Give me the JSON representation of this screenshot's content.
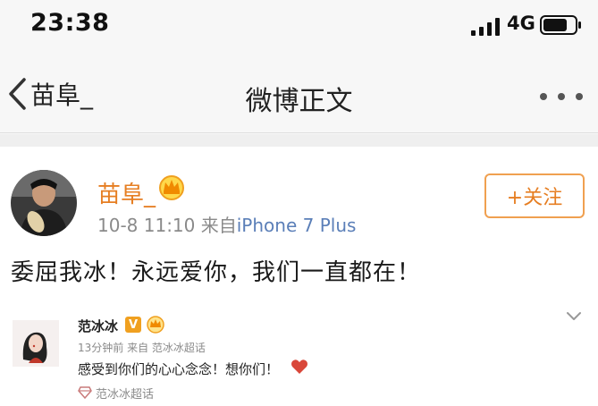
{
  "status_bar": {
    "time": "23:38",
    "network": "4G",
    "icons": [
      "signal-icon",
      "battery-icon"
    ]
  },
  "nav": {
    "back_label": "苗阜_",
    "title": "微博正文",
    "icons": [
      "back-chevron-icon",
      "more-dots-icon"
    ]
  },
  "post": {
    "author": "苗阜_",
    "author_badge_icon": "crown-vip-icon",
    "timestamp": "10-8 11:10",
    "source_prefix": "来自",
    "source": "iPhone 7 Plus",
    "follow_label": "+关注",
    "text": "委屈我冰！永远爱你，我们一直都在！",
    "colors": {
      "name": "#e67e22",
      "meta": "#8a8a8a",
      "source": "#5b7fb8"
    }
  },
  "quoted": {
    "author": "范冰冰",
    "verified_label": "V",
    "meta": "13分钟前 来自 范冰冰超话",
    "text": "感受到你们的心心念念！想你们！",
    "emoji_icon": "heart-icon",
    "topic_label": "范冰冰超话",
    "topic_icon": "diamond-icon",
    "expand_icon": "chevron-down-icon"
  }
}
